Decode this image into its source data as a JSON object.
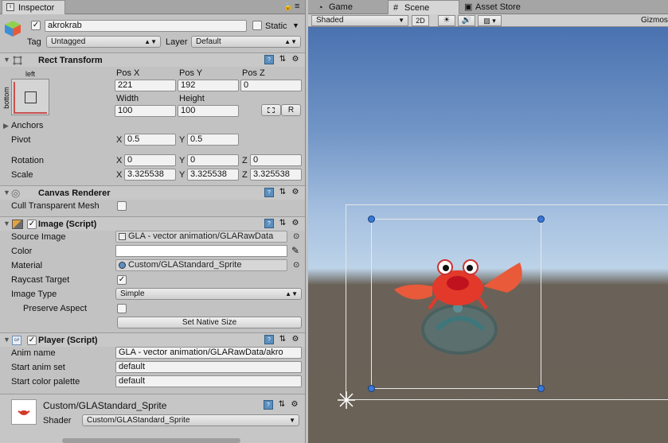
{
  "inspector": {
    "tab_label": "Inspector",
    "object_name": "akrokrab",
    "active": true,
    "static_label": "Static",
    "tag_label": "Tag",
    "tag_value": "Untagged",
    "layer_label": "Layer",
    "layer_value": "Default"
  },
  "rect_transform": {
    "title": "Rect Transform",
    "anchor_h": "left",
    "anchor_v": "bottom",
    "pos_x_label": "Pos X",
    "pos_x": "221",
    "pos_y_label": "Pos Y",
    "pos_y": "192",
    "pos_z_label": "Pos Z",
    "pos_z": "0",
    "width_label": "Width",
    "width": "100",
    "height_label": "Height",
    "height": "100",
    "r_label": "R",
    "anchors_label": "Anchors",
    "pivot_label": "Pivot",
    "pivot_x": "0.5",
    "pivot_y": "0.5",
    "rotation_label": "Rotation",
    "rot_x": "0",
    "rot_y": "0",
    "rot_z": "0",
    "scale_label": "Scale",
    "scale_x": "3.325538",
    "scale_y": "3.325538",
    "scale_z": "3.325538",
    "x": "X",
    "y": "Y",
    "z": "Z"
  },
  "canvas_renderer": {
    "title": "Canvas Renderer",
    "cull_label": "Cull Transparent Mesh",
    "cull": false
  },
  "image_script": {
    "title": "Image (Script)",
    "enabled": true,
    "source_label": "Source Image",
    "source_value": "GLA - vector animation/GLARawData",
    "color_label": "Color",
    "color_value": "#ffffff",
    "material_label": "Material",
    "material_value": "Custom/GLAStandard_Sprite",
    "raycast_label": "Raycast Target",
    "raycast": true,
    "image_type_label": "Image Type",
    "image_type_value": "Simple",
    "preserve_label": "Preserve Aspect",
    "preserve": false,
    "native_size_label": "Set Native Size"
  },
  "player_script": {
    "title": "Player (Script)",
    "enabled": true,
    "anim_name_label": "Anim name",
    "anim_name_value": "GLA - vector animation/GLARawData/akro",
    "start_set_label": "Start anim set",
    "start_set_value": "default",
    "start_palette_label": "Start color palette",
    "start_palette_value": "default"
  },
  "material_section": {
    "title": "Custom/GLAStandard_Sprite",
    "shader_label": "Shader",
    "shader_value": "Custom/GLAStandard_Sprite"
  },
  "scene_tabs": {
    "game": "Game",
    "scene": "Scene",
    "asset_store": "Asset Store"
  },
  "scene_toolbar": {
    "shading": "Shaded",
    "mode_2d": "2D",
    "gizmos": "Gizmos"
  },
  "colors": {
    "accent": "#3a78d8",
    "panel": "#c2c2c2"
  }
}
